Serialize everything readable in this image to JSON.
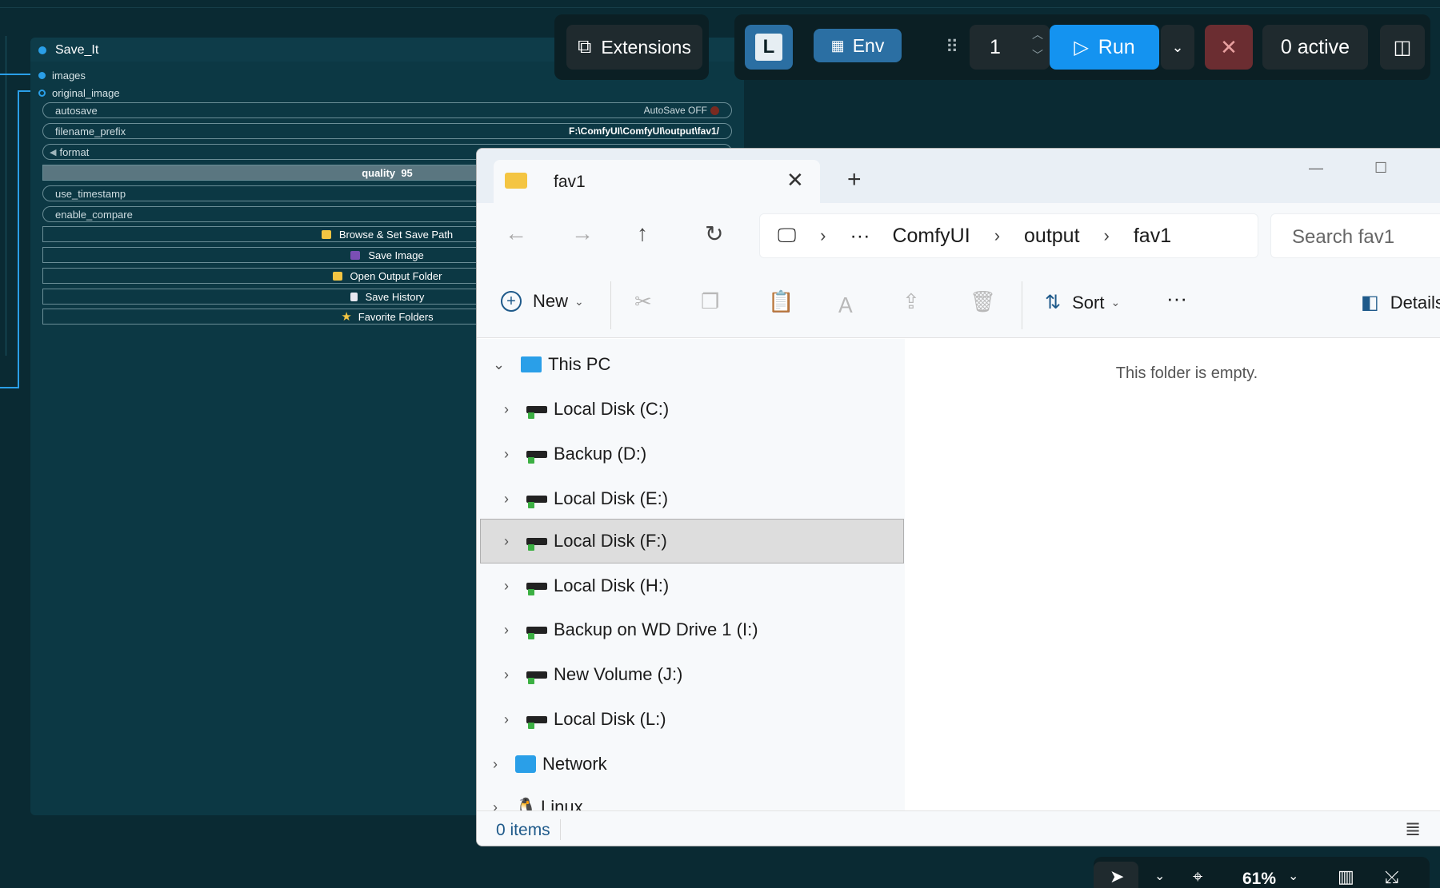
{
  "node": {
    "title": "Save_It",
    "inputs": [
      "images",
      "original_image"
    ],
    "widgets": {
      "autosave": {
        "label": "autosave",
        "value": "AutoSave OFF"
      },
      "filename_prefix": {
        "label": "filename_prefix",
        "value": "F:\\ComfyUI\\ComfyUI\\output\\fav1/"
      },
      "format": {
        "label": "format"
      },
      "quality": {
        "label": "quality",
        "value": "95"
      },
      "use_timestamp": {
        "label": "use_timestamp"
      },
      "enable_compare": {
        "label": "enable_compare"
      }
    },
    "buttons": [
      "Browse & Set Save Path",
      "Save Image",
      "Open Output Folder",
      "Save History",
      "Favorite Folders"
    ]
  },
  "toolbar": {
    "extensions": "Extensions",
    "l_badge": "L",
    "env": "Env",
    "queue_count": "1",
    "run": "Run",
    "active": "0 active"
  },
  "explorer": {
    "tab_title": "fav1",
    "breadcrumbs": [
      "ComfyUI",
      "output",
      "fav1"
    ],
    "search_placeholder": "Search fav1",
    "commands": {
      "new": "New",
      "sort": "Sort",
      "details": "Details"
    },
    "tree": {
      "root": "This PC",
      "drives": [
        "Local Disk (C:)",
        "Backup (D:)",
        "Local Disk (E:)",
        "Local Disk (F:)",
        "Local Disk (H:)",
        "Backup on WD Drive 1 (I:)",
        "New Volume (J:)",
        "Local Disk (L:)"
      ],
      "network": "Network",
      "linux": "Linux"
    },
    "empty_message": "This folder is empty.",
    "status": "0 items"
  },
  "canvas_toolbar": {
    "zoom": "61%"
  },
  "colors": {
    "accent": "#1493f0",
    "node_bg": "#0c3844",
    "canvas_bg": "#0a2a33",
    "stop": "#6b2d31"
  }
}
